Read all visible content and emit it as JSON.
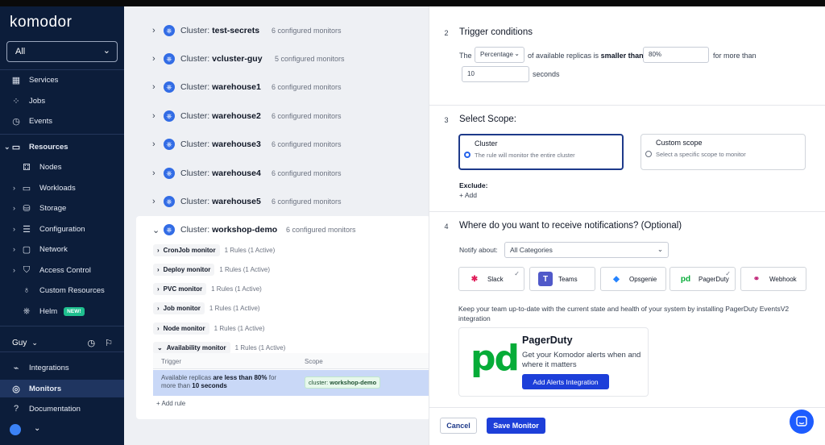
{
  "app": {
    "logo": "komodor"
  },
  "sidebar": {
    "cluster_select": "All",
    "items": [
      {
        "label": "Services"
      },
      {
        "label": "Jobs"
      },
      {
        "label": "Events"
      },
      {
        "label": "Resources"
      },
      {
        "label": "Nodes"
      },
      {
        "label": "Workloads"
      },
      {
        "label": "Storage"
      },
      {
        "label": "Configuration"
      },
      {
        "label": "Network"
      },
      {
        "label": "Access Control"
      },
      {
        "label": "Custom Resources"
      },
      {
        "label": "Helm",
        "badge": "NEW!"
      },
      {
        "label": "Integrations"
      },
      {
        "label": "Monitors"
      },
      {
        "label": "Documentation"
      }
    ],
    "user": "Guy"
  },
  "clusters": [
    {
      "prefix": "Cluster:",
      "name": "test-secrets",
      "count": "6 configured monitors"
    },
    {
      "prefix": "Cluster:",
      "name": "vcluster-guy",
      "count": "5 configured monitors"
    },
    {
      "prefix": "Cluster:",
      "name": "warehouse1",
      "count": "6 configured monitors"
    },
    {
      "prefix": "Cluster:",
      "name": "warehouse2",
      "count": "6 configured monitors"
    },
    {
      "prefix": "Cluster:",
      "name": "warehouse3",
      "count": "6 configured monitors"
    },
    {
      "prefix": "Cluster:",
      "name": "warehouse4",
      "count": "6 configured monitors"
    },
    {
      "prefix": "Cluster:",
      "name": "warehouse5",
      "count": "6 configured monitors"
    },
    {
      "prefix": "Cluster:",
      "name": "workshop-demo",
      "count": "6 configured monitors"
    }
  ],
  "monitors": [
    {
      "name": "CronJob monitor",
      "rules": "1 Rules (1 Active)"
    },
    {
      "name": "Deploy monitor",
      "rules": "1 Rules (1 Active)"
    },
    {
      "name": "PVC monitor",
      "rules": "1 Rules (1 Active)"
    },
    {
      "name": "Job monitor",
      "rules": "1 Rules (1 Active)"
    },
    {
      "name": "Node monitor",
      "rules": "1 Rules (1 Active)"
    },
    {
      "name": "Availability monitor",
      "rules": "1 Rules (1 Active)"
    }
  ],
  "rules_table": {
    "headers": [
      "Trigger",
      "Scope"
    ],
    "row": {
      "trigger_pre": "Available replicas ",
      "trigger_bold1": "are less than 80%",
      "trigger_mid": " for more than ",
      "trigger_bold2": "10 seconds",
      "scope_prefix": "cluster: ",
      "scope_value": "workshop-demo"
    },
    "add_rule": "+ Add rule"
  },
  "panel": {
    "step2": {
      "num": "2",
      "title": "Trigger conditions",
      "the": "The",
      "select": "Percentage",
      "text1": "of available replicas is",
      "bold": "smaller than",
      "value": "80%",
      "text2": "for more than",
      "seconds_value": "10",
      "seconds": "seconds"
    },
    "step3": {
      "num": "3",
      "title": "Select Scope:",
      "cluster_title": "Cluster",
      "cluster_desc": "The rule will monitor the entire cluster",
      "custom_title": "Custom scope",
      "custom_desc": "Select a specific scope to monitor",
      "exclude": "Exclude:",
      "add": "+ Add"
    },
    "step4": {
      "num": "4",
      "title": "Where do you want to receive notifications? (Optional)",
      "notify_label": "Notify about:",
      "notify_value": "All Categories",
      "channels": [
        {
          "label": "Slack",
          "checked": true
        },
        {
          "label": "Teams",
          "checked": false
        },
        {
          "label": "Opsgenie",
          "checked": false
        },
        {
          "label": "PagerDuty",
          "checked": true
        },
        {
          "label": "Webhook",
          "checked": false
        }
      ],
      "info": "Keep your team up-to-date with the current state and health of your system by installing PagerDuty EventsV2 integration",
      "pd_title": "PagerDuty",
      "pd_desc": "Get your Komodor alerts when and where it matters",
      "pd_button": "Add Alerts Integration"
    },
    "cancel": "Cancel",
    "save": "Save Monitor"
  },
  "colors": {
    "sidebar_bg": "#0c1d3a",
    "primary": "#1d3fd9",
    "selected_row": "#c9d8f7"
  }
}
